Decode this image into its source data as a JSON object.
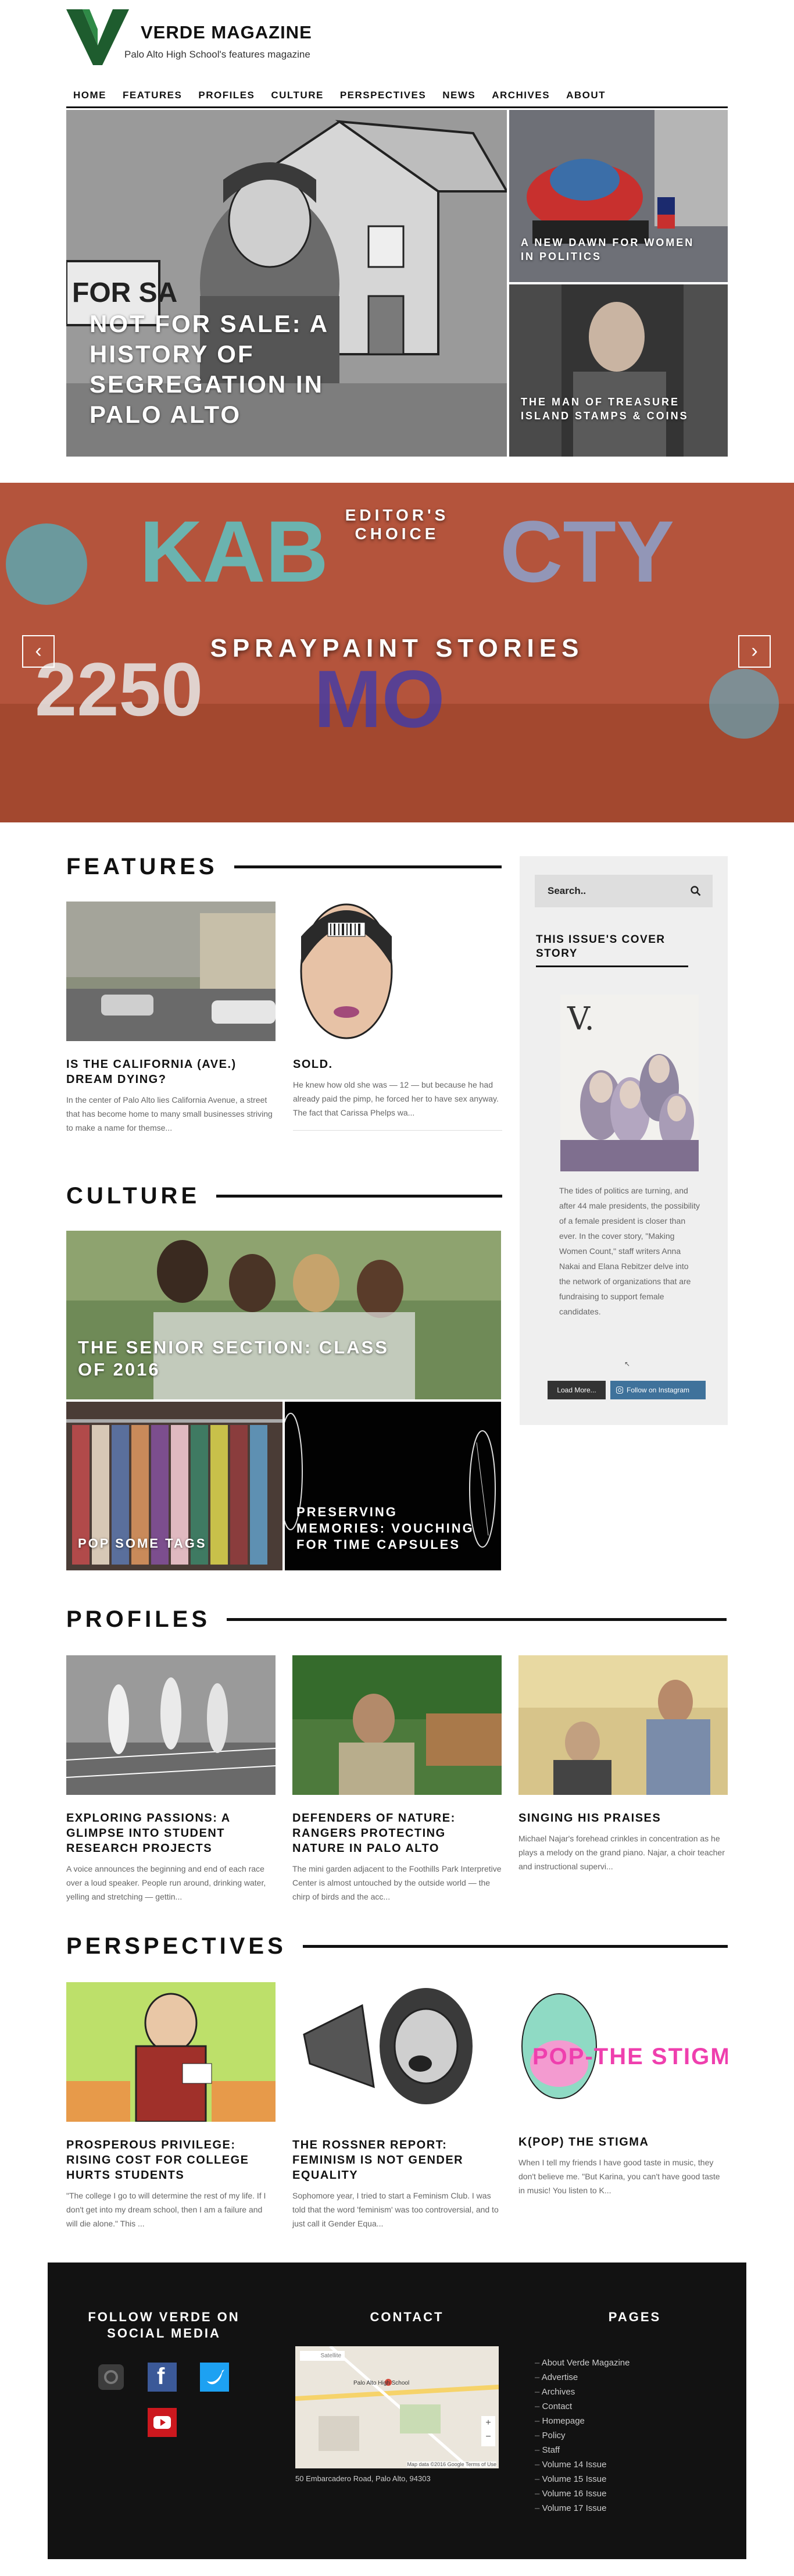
{
  "site": {
    "name": "VERDE MAGAZINE",
    "tagline": "Palo Alto High School's features magazine",
    "brand_color": "#1e5c2e"
  },
  "nav": [
    "HOME",
    "FEATURES",
    "PROFILES",
    "CULTURE",
    "PERSPECTIVES",
    "NEWS",
    "ARCHIVES",
    "ABOUT"
  ],
  "hero": {
    "main": "NOT FOR SALE: A HISTORY OF SEGREGATION IN PALO ALTO",
    "top_right": "A NEW DAWN FOR WOMEN IN POLITICS",
    "bottom_right": "THE MAN OF TREASURE ISLAND STAMPS & COINS"
  },
  "slider": {
    "badge": "EDITOR'S CHOICE",
    "title": "SPRAYPAINT STORIES"
  },
  "features": {
    "heading": "FEATURES",
    "cards": [
      {
        "title": "IS THE CALIFORNIA (AVE.) DREAM DYING?",
        "excerpt": "In the center of Palo Alto lies California Avenue, a street that has become home to many small businesses striving to make a name for themse..."
      },
      {
        "title": "SOLD.",
        "excerpt": "He knew how old she was — 12 — but because he had already paid the pimp, he forced her to have sex anyway. The fact that Carissa Phelps wa..."
      }
    ]
  },
  "sidebar": {
    "search_placeholder": "Search..",
    "cover_heading": "THIS ISSUE'S COVER STORY",
    "cover_text": "The tides of politics are turning, and after 44 male presidents, the possibility of a female president is closer than ever. In the cover story, \"Making Women Count,\" staff writers Anna Nakai and Elana Rebitzer delve into the network of organizations that are fundraising to support female candidates.",
    "load_more": "Load More...",
    "follow_instagram": "Follow on Instagram"
  },
  "culture": {
    "heading": "CULTURE",
    "main": "THE SENIOR SECTION: CLASS OF 2016",
    "left": "POP SOME TAGS",
    "right": "PRESERVING MEMORIES: VOUCHING FOR TIME CAPSULES"
  },
  "profiles": {
    "heading": "PROFILES",
    "cards": [
      {
        "title": "EXPLORING PASSIONS: A GLIMPSE INTO STUDENT RESEARCH PROJECTS",
        "excerpt": "A voice announces the beginning and end of each race over a loud speaker. People run around, drinking water, yelling and stretching — gettin..."
      },
      {
        "title": "DEFENDERS OF NATURE: RANGERS PROTECTING NATURE IN PALO ALTO",
        "excerpt": "The mini garden adjacent to the Foothills Park Interpretive Center is almost untouched by the outside world — the chirp of birds and the acc..."
      },
      {
        "title": "SINGING HIS PRAISES",
        "excerpt": "Michael Najar's forehead crinkles in concentration as he plays a melody on the grand piano. Najar, a choir teacher and instructional supervi..."
      }
    ]
  },
  "perspectives": {
    "heading": "PERSPECTIVES",
    "cards": [
      {
        "title": "PROSPEROUS PRIVILEGE: RISING COST FOR COLLEGE HURTS STUDENTS",
        "excerpt": "\"The college I go to will determine the rest of my life. If I don't get into my dream school, then I am a failure and will die alone.\" This ..."
      },
      {
        "title": "THE ROSSNER REPORT: FEMINISM IS NOT GENDER EQUALITY",
        "excerpt": "Sophomore year, I tried to start a Feminism Club. I was told that the word 'feminism' was too controversial, and to just call it Gender Equa..."
      },
      {
        "title": "K(POP) THE STIGMA",
        "excerpt": "When I tell my friends I have good taste in music, they don't believe me. \"But Karina, you can't have good taste in music! You listen to K..."
      }
    ],
    "pop_text": "POP-THE STIGMA"
  },
  "footer": {
    "social_heading": "FOLLOW VERDE ON SOCIAL MEDIA",
    "contact_heading": "CONTACT",
    "pages_heading": "PAGES",
    "address": "50 Embarcadero Road, Palo Alto, 94303",
    "map_tabs": [
      "Map",
      "Satellite"
    ],
    "map_label": "Palo Alto High School",
    "map_footer": "Map data ©2016 Google  Terms of Use",
    "pages": [
      "About Verde Magazine",
      "Advertise",
      "Archives",
      "Contact",
      "Homepage",
      "Policy",
      "Staff",
      "Volume 14 Issue",
      "Volume 15 Issue",
      "Volume 16 Issue",
      "Volume 17 Issue"
    ]
  }
}
